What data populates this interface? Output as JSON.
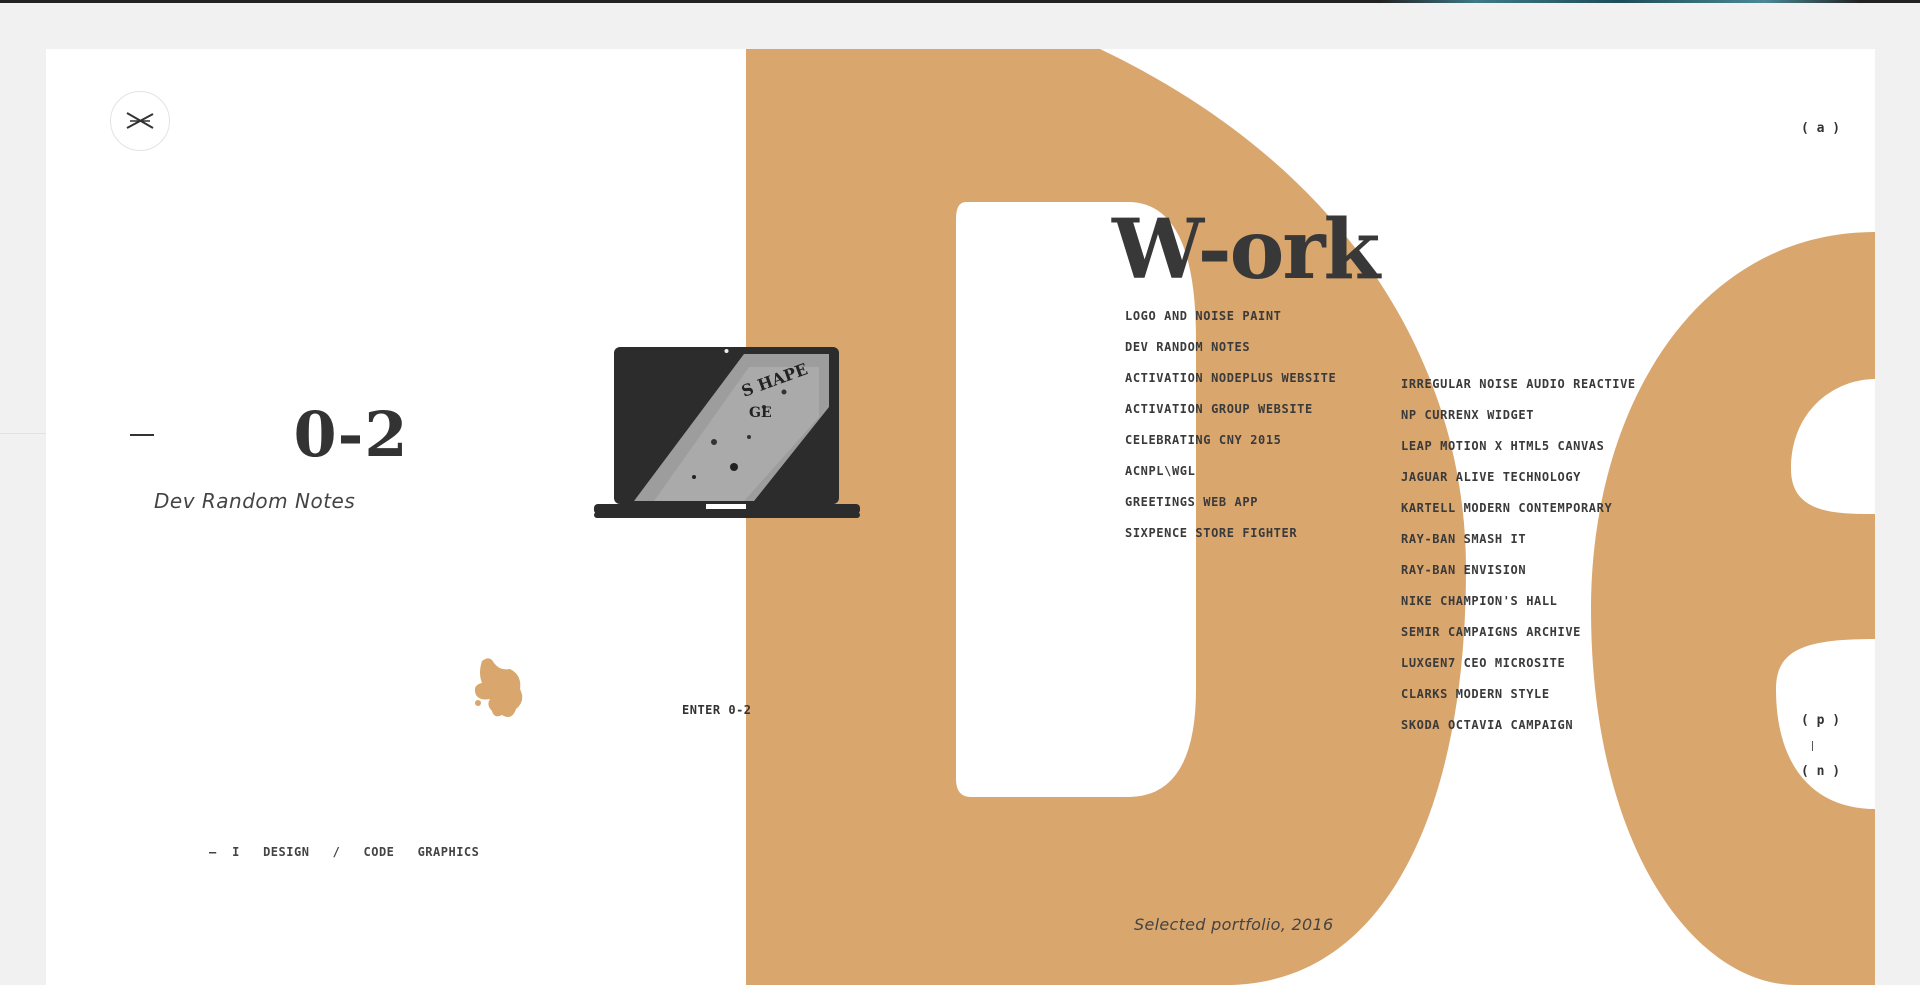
{
  "colors": {
    "accent": "#d9a66e",
    "text": "#333333",
    "background": "#f1f1f1",
    "panel": "#ffffff"
  },
  "logo": {
    "icon": "cross-logo-icon"
  },
  "project": {
    "number": "0-2",
    "name": "Dev Random Notes",
    "enter_label": "ENTER 0-2",
    "tags": "—  I   DESIGN   /   CODE   GRAPHICS"
  },
  "work": {
    "title": "W-ork",
    "caption": "Selected portfolio, 2016",
    "column1": [
      "LOGO AND NOISE PAINT",
      "DEV RANDOM NOTES",
      "ACTIVATION NODEPLUS WEBSITE",
      "ACTIVATION GROUP WEBSITE",
      "CELEBRATING CNY 2015",
      "ACNPL\\WGL",
      "GREETINGS WEB APP",
      "SIXPENCE STORE FIGHTER"
    ],
    "column2": [
      "IRREGULAR NOISE AUDIO REACTIVE",
      "NP CURRENX WIDGET",
      "LEAP MOTION X HTML5 CANVAS",
      "JAGUAR ALIVE TECHNOLOGY",
      "KARTELL MODERN CONTEMPORARY",
      "RAY-BAN SMASH IT",
      "RAY-BAN ENVISION",
      "NIKE CHAMPION'S HALL",
      "SEMIR CAMPAIGNS ARCHIVE",
      "LUXGEN7 CEO MICROSITE",
      "CLARKS MODERN STYLE",
      "SKODA OCTAVIA CAMPAIGN"
    ]
  },
  "nav": {
    "about": "( a )",
    "prev": "( p )",
    "separator": "|",
    "next": "( n )"
  }
}
